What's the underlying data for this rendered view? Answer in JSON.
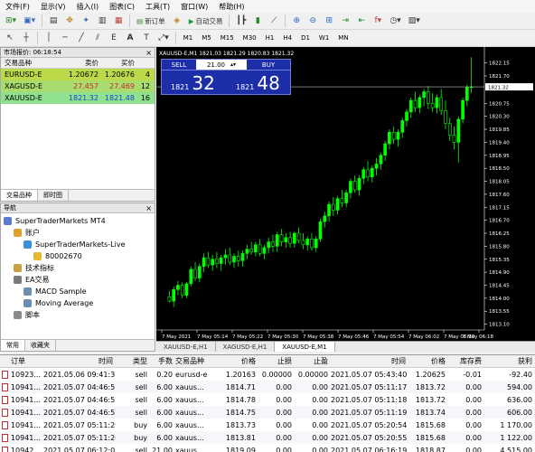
{
  "menu": [
    "文件(F)",
    "显示(V)",
    "插入(I)",
    "图表(C)",
    "工具(T)",
    "窗口(W)",
    "帮助(H)"
  ],
  "toolbar": {
    "new_order": "新订单",
    "autotrading": "自动交易"
  },
  "timeframes": [
    "M1",
    "M5",
    "M15",
    "M30",
    "H1",
    "H4",
    "D1",
    "W1",
    "MN"
  ],
  "active_timeframe": "M1",
  "market_watch": {
    "title": "市场报价: 06:18:54",
    "headers": {
      "symbol": "交易品种",
      "bid": "卖价",
      "ask": "买价",
      "spread": ""
    },
    "rows": [
      {
        "symbol": "EURUSD-E",
        "bid": "1.20672",
        "ask": "1.20676",
        "spread": "4",
        "bg": "#bcd94a",
        "bid_color": "#000000",
        "ask_color": "#000000"
      },
      {
        "symbol": "XAGUSD-E",
        "bid": "27.457",
        "ask": "27.469",
        "spread": "12",
        "bg": "#a8dc6e",
        "bid_color": "#cc2a2a",
        "ask_color": "#cc2a2a"
      },
      {
        "symbol": "XAUUSD-E",
        "bid": "1821.32",
        "ask": "1821.48",
        "spread": "16",
        "bg": "#8fe08f",
        "bid_color": "#1a44cc",
        "ask_color": "#1a44cc"
      }
    ],
    "tabs": [
      "交易品种",
      "即时图"
    ]
  },
  "navigator": {
    "title": "导航",
    "items": [
      {
        "label": "SuperTraderMarkets MT4",
        "icon": "terminal-icon",
        "indent": 0,
        "color": "#5a7bd0"
      },
      {
        "label": "账户",
        "icon": "accounts-icon",
        "indent": 1,
        "color": "#e0a030"
      },
      {
        "label": "SuperTraderMarkets-Live",
        "icon": "server-icon",
        "indent": 2,
        "color": "#3a8fd8"
      },
      {
        "label": "80002670",
        "icon": "user-icon",
        "indent": 3,
        "color": "#e6b830"
      },
      {
        "label": "技术指标",
        "icon": "indicators-icon",
        "indent": 1,
        "color": "#c8a040"
      },
      {
        "label": "EA交易",
        "icon": "expert-advisors-icon",
        "indent": 1,
        "color": "#7a7a7a"
      },
      {
        "label": "MACD Sample",
        "icon": "ea-icon",
        "indent": 2,
        "color": "#6a8fb0"
      },
      {
        "label": "Moving Average",
        "icon": "ea-icon",
        "indent": 2,
        "color": "#6a8fb0"
      },
      {
        "label": "脚本",
        "icon": "scripts-icon",
        "indent": 1,
        "color": "#8a8a8a"
      }
    ],
    "tabs": [
      "常用",
      "收藏夹"
    ]
  },
  "chart": {
    "header": "XAUUSD-E,M1  1821.03 1821.29 1820.83 1821.32",
    "symbol": "XAUUSD-E,M1",
    "one_click": {
      "sell_label": "SELL",
      "buy_label": "BUY",
      "volume": "21.00",
      "sell_prefix": "1821",
      "sell_big": "32",
      "buy_prefix": "1821",
      "buy_big": "48"
    },
    "price_label": "1821.32",
    "tabs": [
      "XAUUSD-E,H1",
      "XAGUSD-E,H1",
      "XAUUSD-E,M1"
    ],
    "active_tab": 2
  },
  "chart_data": {
    "type": "candlestick",
    "symbol": "XAUUSD-E",
    "timeframe": "M1",
    "price_ticks": [
      "1822.15",
      "1821.70",
      "1821.32",
      "1820.75",
      "1820.30",
      "1819.85",
      "1819.40",
      "1818.95",
      "1818.50",
      "1818.05",
      "1817.60",
      "1817.15",
      "1816.70",
      "1816.25",
      "1815.80",
      "1815.35",
      "1814.90",
      "1814.45",
      "1814.00",
      "1813.55",
      "1813.10"
    ],
    "time_ticks": [
      "7 May 2021",
      "7 May 05:14",
      "7 May 05:22",
      "7 May 05:30",
      "7 May 05:38",
      "7 May 05:46",
      "7 May 05:54",
      "7 May 06:02",
      "7 May 06:10",
      "7 May 06:18"
    ],
    "ylim": [
      1812.9,
      1822.45
    ],
    "current_price": 1821.32,
    "candles": [
      [
        1814.05,
        1814.25,
        1813.85,
        1813.9
      ],
      [
        1813.9,
        1814.4,
        1813.7,
        1814.3
      ],
      [
        1814.3,
        1814.6,
        1814.1,
        1814.45
      ],
      [
        1814.45,
        1814.55,
        1814.0,
        1814.1
      ],
      [
        1814.1,
        1814.55,
        1814.0,
        1814.5
      ],
      [
        1814.5,
        1815.1,
        1814.4,
        1815.0
      ],
      [
        1815.0,
        1815.25,
        1814.6,
        1814.7
      ],
      [
        1814.7,
        1815.2,
        1814.55,
        1815.1
      ],
      [
        1815.1,
        1815.55,
        1814.9,
        1815.4
      ],
      [
        1815.4,
        1815.6,
        1815.05,
        1815.15
      ],
      [
        1815.15,
        1815.5,
        1814.95,
        1815.35
      ],
      [
        1815.35,
        1815.6,
        1815.05,
        1815.2
      ],
      [
        1815.2,
        1815.5,
        1814.95,
        1815.4
      ],
      [
        1815.4,
        1815.7,
        1815.15,
        1815.5
      ],
      [
        1815.5,
        1815.75,
        1815.15,
        1815.25
      ],
      [
        1815.25,
        1815.55,
        1815.05,
        1815.45
      ],
      [
        1815.45,
        1815.65,
        1815.1,
        1815.3
      ],
      [
        1815.3,
        1815.65,
        1815.1,
        1815.55
      ],
      [
        1815.55,
        1815.85,
        1815.35,
        1815.7
      ],
      [
        1815.7,
        1815.95,
        1815.5,
        1815.6
      ],
      [
        1815.6,
        1815.95,
        1815.45,
        1815.85
      ],
      [
        1815.85,
        1816.05,
        1815.45,
        1815.55
      ],
      [
        1815.55,
        1815.85,
        1815.35,
        1815.75
      ],
      [
        1815.75,
        1816.1,
        1815.55,
        1815.95
      ],
      [
        1815.95,
        1816.2,
        1815.6,
        1815.8
      ],
      [
        1815.8,
        1816.3,
        1815.6,
        1816.2
      ],
      [
        1816.2,
        1816.4,
        1815.8,
        1815.95
      ],
      [
        1815.95,
        1816.25,
        1815.75,
        1816.1
      ],
      [
        1816.1,
        1816.3,
        1815.75,
        1815.9
      ],
      [
        1815.9,
        1816.3,
        1815.75,
        1816.25
      ],
      [
        1816.25,
        1816.45,
        1815.9,
        1816.0
      ],
      [
        1816.0,
        1816.25,
        1815.7,
        1815.85
      ],
      [
        1815.85,
        1816.15,
        1815.65,
        1816.05
      ],
      [
        1816.05,
        1816.25,
        1815.65,
        1815.75
      ],
      [
        1815.75,
        1816.15,
        1815.6,
        1816.05
      ],
      [
        1816.05,
        1816.75,
        1815.95,
        1816.65
      ],
      [
        1816.65,
        1817.0,
        1816.45,
        1816.85
      ],
      [
        1816.85,
        1817.35,
        1816.65,
        1817.25
      ],
      [
        1817.25,
        1817.5,
        1816.85,
        1817.05
      ],
      [
        1817.05,
        1817.55,
        1816.9,
        1817.45
      ],
      [
        1817.45,
        1817.75,
        1817.15,
        1817.3
      ],
      [
        1817.3,
        1817.75,
        1817.15,
        1817.65
      ],
      [
        1817.65,
        1818.15,
        1817.45,
        1818.05
      ],
      [
        1818.05,
        1818.25,
        1817.65,
        1817.75
      ],
      [
        1817.75,
        1818.25,
        1817.55,
        1818.15
      ],
      [
        1818.15,
        1818.55,
        1817.95,
        1818.45
      ],
      [
        1818.45,
        1818.75,
        1818.05,
        1818.2
      ],
      [
        1818.2,
        1818.6,
        1818.0,
        1818.5
      ],
      [
        1818.5,
        1818.85,
        1818.25,
        1818.65
      ],
      [
        1818.65,
        1819.05,
        1818.45,
        1818.95
      ],
      [
        1818.95,
        1819.45,
        1818.75,
        1819.35
      ],
      [
        1819.35,
        1819.85,
        1819.15,
        1819.75
      ],
      [
        1819.75,
        1819.95,
        1819.35,
        1819.5
      ],
      [
        1819.5,
        1819.85,
        1819.25,
        1819.75
      ],
      [
        1819.75,
        1820.25,
        1819.55,
        1820.15
      ],
      [
        1820.15,
        1820.55,
        1819.95,
        1820.45
      ],
      [
        1820.45,
        1820.95,
        1820.25,
        1820.85
      ],
      [
        1820.85,
        1821.15,
        1820.45,
        1820.6
      ],
      [
        1820.6,
        1821.05,
        1820.4,
        1820.95
      ],
      [
        1820.95,
        1821.25,
        1820.65,
        1821.15
      ],
      [
        1821.15,
        1821.35,
        1820.55,
        1820.75
      ],
      [
        1820.75,
        1821.1,
        1820.45,
        1820.6
      ],
      [
        1820.6,
        1821.05,
        1820.4,
        1820.95
      ],
      [
        1820.95,
        1821.25,
        1820.35,
        1820.5
      ],
      [
        1820.5,
        1820.85,
        1819.85,
        1820.05
      ],
      [
        1820.05,
        1820.25,
        1819.45,
        1819.65
      ],
      [
        1819.65,
        1819.95,
        1819.15,
        1819.4
      ],
      [
        1819.4,
        1820.3,
        1818.7,
        1820.2
      ],
      [
        1820.2,
        1820.95,
        1820.05,
        1820.85
      ],
      [
        1820.85,
        1821.4,
        1820.65,
        1821.3
      ],
      [
        1821.3,
        1822.35,
        1821.1,
        1821.32
      ]
    ]
  },
  "terminal": {
    "headers": [
      "订单",
      "时间",
      "类型",
      "手数",
      "交易品种",
      "价格",
      "止损",
      "止盈",
      "时间",
      "价格",
      "库存费",
      "获利"
    ],
    "rows": [
      [
        "10923...",
        "2021.05.06 09:41:37",
        "sell",
        "0.20",
        "eurusd-e",
        "1.20163",
        "0.00000",
        "0.00000",
        "2021.05.07 05:43:40",
        "1.20625",
        "-0.01",
        "-92.40"
      ],
      [
        "10941...",
        "2021.05.07 04:46:51",
        "sell",
        "6.00",
        "xauus...",
        "1814.71",
        "0.00",
        "0.00",
        "2021.05.07 05:11:17",
        "1813.72",
        "0.00",
        "594.00"
      ],
      [
        "10941...",
        "2021.05.07 04:46:52",
        "sell",
        "6.00",
        "xauus...",
        "1814.78",
        "0.00",
        "0.00",
        "2021.05.07 05:11:18",
        "1813.72",
        "0.00",
        "636.00"
      ],
      [
        "10941...",
        "2021.05.07 04:46:53",
        "sell",
        "6.00",
        "xauus...",
        "1814.75",
        "0.00",
        "0.00",
        "2021.05.07 05:11:19",
        "1813.74",
        "0.00",
        "606.00"
      ],
      [
        "10941...",
        "2021.05.07 05:11:20",
        "buy",
        "6.00",
        "xauus...",
        "1813.73",
        "0.00",
        "0.00",
        "2021.05.07 05:20:54",
        "1815.68",
        "0.00",
        "1 170.00"
      ],
      [
        "10941...",
        "2021.05.07 05:11:20",
        "buy",
        "6.00",
        "xauus...",
        "1813.81",
        "0.00",
        "0.00",
        "2021.05.07 05:20:55",
        "1815.68",
        "0.00",
        "1 122.00"
      ],
      [
        "10942...",
        "2021.05.07 06:12:08",
        "sell",
        "21.00",
        "xauus...",
        "1819.09",
        "0.00",
        "0.00",
        "2021.05.07 06:16:19",
        "1818.87",
        "0.00",
        "4 515.00"
      ]
    ]
  },
  "colors": {
    "bull": "#00ff00",
    "bear": "#000000",
    "wick": "#00ff00",
    "grid": "#000000",
    "axis_text": "#ffffff",
    "one_click_bg": "#1c2ea8"
  }
}
